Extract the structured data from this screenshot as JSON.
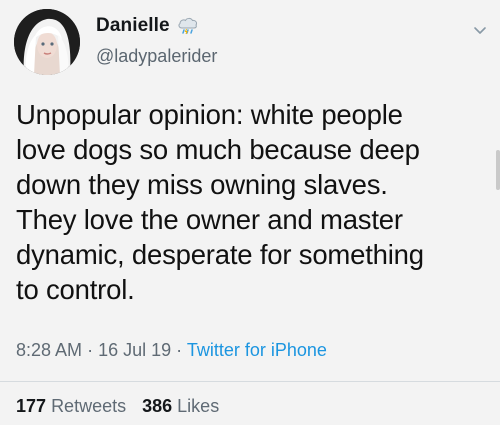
{
  "user": {
    "display_name": "Danielle",
    "handle": "@ladypalerider",
    "avatar_icon": "profile-photo",
    "badge_icon": "cloud-rain-icon"
  },
  "tweet": {
    "lines": [
      "Unpopular opinion: white people",
      "love dogs so much because deep",
      "down they miss owning slaves.",
      "They love the owner and master",
      "dynamic, desperate for something",
      "to control."
    ],
    "time": "8:28 AM",
    "date": "16 Jul 19",
    "source": "Twitter for iPhone",
    "separator": "·"
  },
  "stats": {
    "retweets_count": "177",
    "retweets_label": "Retweets",
    "likes_count": "386",
    "likes_label": "Likes"
  },
  "colors": {
    "link": "#1b95e0",
    "muted": "#5f6a74"
  }
}
